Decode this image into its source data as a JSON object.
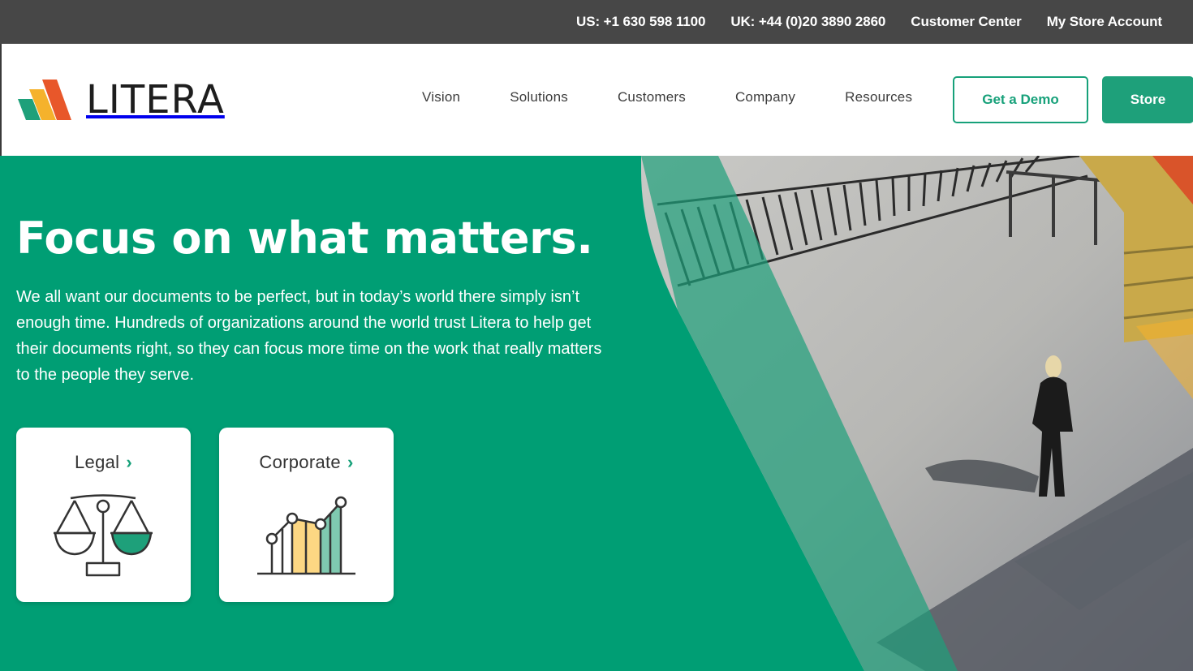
{
  "topbar": {
    "us_phone": "US: +1 630 598 1100",
    "uk_phone": "UK: +44 (0)20 3890 2860",
    "customer_center": "Customer Center",
    "store_account": "My Store Account"
  },
  "header": {
    "logo_text": "LITERA",
    "nav": [
      "Vision",
      "Solutions",
      "Customers",
      "Company",
      "Resources"
    ],
    "demo_label": "Get a Demo",
    "store_label": "Store"
  },
  "hero": {
    "title": "Focus on what matters.",
    "body": "We all want our documents to be perfect, but in today’s world there simply isn’t enough time. Hundreds of organizations around the world trust Litera to help get their documents right, so they can focus more time on the work that really matters to the people they serve.",
    "cards": [
      {
        "label": "Legal",
        "icon": "scales-icon"
      },
      {
        "label": "Corporate",
        "icon": "bar-line-chart-icon"
      }
    ],
    "chevron": "›"
  },
  "colors": {
    "brand_green": "#009e74",
    "topbar": "#474747",
    "logo_green": "#1ea07a",
    "logo_yellow": "#f5b22c",
    "logo_orange": "#e8572a"
  }
}
